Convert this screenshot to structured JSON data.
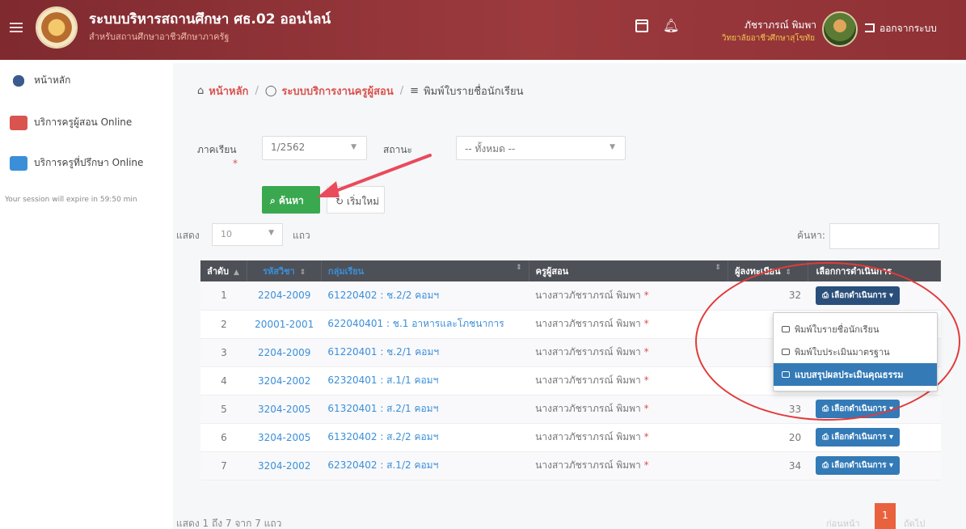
{
  "header": {
    "title": "ระบบบริหารสถานศึกษา ศธ.02 ออนไลน์",
    "subtitle": "สำหรับสถานศึกษาอาชีวศึกษาภาครัฐ",
    "user_name": "ภัชราภรณ์ พิมพา",
    "user_org": "วิทยาลัยอาชีวศึกษาสุโขทัย",
    "logout_label": "ออกจากระบบ",
    "header_color": "#8f3135"
  },
  "sidebar": {
    "items": [
      {
        "label": "หน้าหลัก",
        "icon": "dashboard-icon"
      },
      {
        "label": "บริการครูผู้สอน Online",
        "icon": "teacher-icon"
      },
      {
        "label": "บริการครูที่ปรึกษา Online",
        "icon": "monitor-icon"
      }
    ],
    "session_text": "Your session will expire in 59:50 min"
  },
  "breadcrumb": {
    "home": "หน้าหลัก",
    "section": "ระบบบริการงานครูผู้สอน",
    "current": "พิมพ์ใบรายชื่อนักเรียน"
  },
  "filters": {
    "semester_label": "ภาคเรียน",
    "semester_value": "1/2562",
    "status_label": "สถานะ",
    "status_value": "-- ทั้งหมด --",
    "search_button": "ค้นหา",
    "reset_button": "เริ่มใหม่"
  },
  "table_controls": {
    "show_label": "แสดง",
    "page_length": "10",
    "rows_label": "แถว",
    "search_label": "ค้นหา:"
  },
  "table": {
    "columns": [
      "ลำดับ",
      "รหัสวิชา",
      "กลุ่มเรียน",
      "ครูผู้สอน",
      "ผู้ลงทะเบียน",
      "เลือกการดำเนินการ"
    ],
    "action_label": "เลือกดำเนินการ",
    "rows": [
      {
        "no": "1",
        "code": "2204-2009",
        "group": "61220402 : ช.2/2 คอมฯ",
        "teacher": "นางสาวภัชราภรณ์ พิมพา",
        "count": "32"
      },
      {
        "no": "2",
        "code": "20001-2001",
        "group": "622040401 : ช.1 อาหารและโภชนาการ",
        "teacher": "นางสาวภัชราภรณ์ พิมพา",
        "count": ""
      },
      {
        "no": "3",
        "code": "2204-2009",
        "group": "61220401 : ช.2/1 คอมฯ",
        "teacher": "นางสาวภัชราภรณ์ พิมพา",
        "count": ""
      },
      {
        "no": "4",
        "code": "3204-2002",
        "group": "62320401 : ส.1/1 คอมฯ",
        "teacher": "นางสาวภัชราภรณ์ พิมพา",
        "count": ""
      },
      {
        "no": "5",
        "code": "3204-2005",
        "group": "61320401 : ส.2/1 คอมฯ",
        "teacher": "นางสาวภัชราภรณ์ พิมพา",
        "count": "33"
      },
      {
        "no": "6",
        "code": "3204-2005",
        "group": "61320402 : ส.2/2 คอมฯ",
        "teacher": "นางสาวภัชราภรณ์ พิมพา",
        "count": "20"
      },
      {
        "no": "7",
        "code": "3204-2002",
        "group": "62320402 : ส.1/2 คอมฯ",
        "teacher": "นางสาวภัชราภรณ์ พิมพา",
        "count": "34"
      }
    ]
  },
  "dropdown": {
    "items": [
      "พิมพ์ใบรายชื่อนักเรียน",
      "พิมพ์ใบประเมินมาตรฐาน",
      "แบบสรุปผลประเมินคุณธรรม"
    ]
  },
  "footer": {
    "info": "แสดง 1 ถึง 7 จาก 7 แถว",
    "prev": "ก่อนหน้า",
    "page": "1",
    "next": "ถัดไป"
  }
}
